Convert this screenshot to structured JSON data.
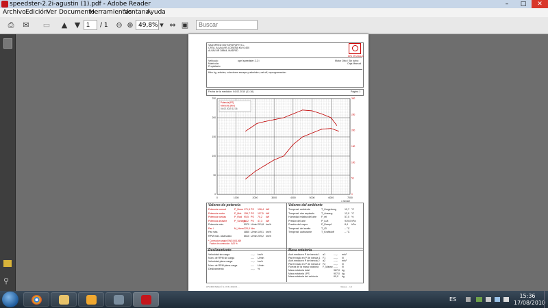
{
  "window": {
    "title": "speedster-2.2i-agustin (1).pdf - Adobe Reader",
    "minimize": "–",
    "maximize": "□",
    "close": "✕"
  },
  "menu": [
    "Archivo",
    "Edición",
    "Ver",
    "Documento",
    "Herramientas",
    "Ventana",
    "Ayuda"
  ],
  "toolbar": {
    "page_current": "1",
    "page_total": "/ 1",
    "zoom": "49,8%",
    "search_placeholder": "Buscar"
  },
  "doc": {
    "company": [
      "VAGSPEED MOTORSPORT S.L.",
      "CRTA. ALVALVIR-COBEÑA KM 0,400",
      "ALVALVIR 28864, MADRID"
    ],
    "logo_caption": "RPS ZTG/MAHA",
    "vehicle_label": "Vehículo:",
    "vehicle_value": "opel speedster 2.2 i",
    "matricula_label": "Matrícula:",
    "prop_label": "Propietario:",
    "motor_label": "Motor Otto / Sin turbo",
    "caja_label": "Caja Manual",
    "note": "filtro kg, arboles, colectores escape y admision, cat.off, reprogramacion.",
    "fecha": "Fecha de la medición: 04.02.2010 (11:16)",
    "pagina": "Página 1",
    "legend": [
      "Potencia [PS]",
      "Momento [Nm]",
      "04.02.2010 11:16"
    ],
    "rpm_unit": "n [U/min]",
    "sec_potencia": "Valores de potencia",
    "sec_ambiente": "Valores del ambiente",
    "sec_deslizamiento": "Deslizamiento",
    "sec_masa": "Masa rotatoria",
    "potencia_rows": [
      [
        "Potencia normal",
        "P_Norm",
        "171,9",
        "PS",
        "126,4",
        "kW"
      ],
      [
        "Potencia motor",
        "P_Mot",
        "159,7",
        "PS",
        "117,5",
        "kW"
      ],
      [
        "Potencia ruedas",
        "P_Rad",
        "95,5",
        "PS",
        "70,2",
        "kW"
      ],
      [
        "Potencia arrastre",
        "P_Schlepp",
        "64,2",
        "PS",
        "47,3",
        "kW"
      ],
      [
        "Potencia máx.",
        "",
        "5570",
        "U/min",
        "201,8",
        "km/h"
      ],
      [
        "Par I",
        "M_Norm",
        "220,0",
        "Nm",
        "",
        ""
      ],
      [
        "Par máx.",
        "",
        "4860",
        "U/min",
        "149,1",
        "km/h"
      ],
      [
        "RPM máx. alcanzado",
        "",
        "6610",
        "U/min",
        "209,2",
        "km/h"
      ]
    ],
    "correccion": [
      "* Corrección según EWG 80/1269",
      "Factor de corrección: 0,00 %"
    ],
    "ambiente_rows": [
      [
        "Temperat. ambiente",
        "T_Umgebung",
        "12,7",
        "°C"
      ],
      [
        "Temperat. aire aspirado",
        "T_Ansaug",
        "12,0",
        "°C"
      ],
      [
        "Humedad relativa del aire",
        "F_rel",
        "57,0",
        "%"
      ],
      [
        "Presión del aire",
        "P_Luft",
        "919,0",
        "hPa"
      ],
      [
        "Presión del vapor",
        "P_Dampf",
        "8,4",
        "hPa"
      ],
      [
        "Temperat. del aceite",
        "T_Öl",
        "-- °C",
        ""
      ],
      [
        "Temperat. carburante",
        "T_Kraftstoff",
        "-- °C",
        ""
      ]
    ],
    "desliz_rows": [
      [
        "Velocidad sin carga",
        "",
        "---,-",
        "km/h"
      ],
      [
        "Núm. de RPM sin carga",
        "",
        "----",
        "U/min"
      ],
      [
        "Velocidad plena carga",
        "",
        "---,-",
        "km/h"
      ],
      [
        "Núm. de RPM plena carga",
        "",
        "----",
        "U/min"
      ],
      [
        "Deslizamiento",
        "",
        "---,-",
        "%"
      ]
    ],
    "masa_rows": [
      [
        "Acel.media en P de inercia 1",
        "a1",
        "---,-",
        "m/s²"
      ],
      [
        "Par.frenado en P de inercia 1",
        "F1",
        "---,-",
        "N"
      ],
      [
        "Acel.media en P de inercia 2",
        "a2",
        "---,-",
        "m/s²"
      ],
      [
        "Par.frenado en P de inercia 2",
        "F2",
        "---,-",
        "N"
      ],
      [
        "Fuerza de la masa rotatoria",
        "F_Masse",
        "---,-",
        "N"
      ],
      [
        "Masa rotatoria total",
        "",
        "967,0",
        "kg"
      ],
      [
        "Masa rotatoria LPS",
        "",
        "907,0",
        "kg"
      ],
      [
        "Masa rotatoria del vehículo",
        "",
        "60,0",
        "kg"
      ]
    ],
    "footer": [
      "LPS 3000 MAHA © 1.2.6.5 | 2010.01 ...",
      "",
      "Valores ... 1/1"
    ]
  },
  "chart_data": {
    "type": "line",
    "xlabel": "n [U/min]",
    "x_ticks": [
      0,
      1000,
      2000,
      3000,
      4000,
      5000,
      6000,
      7000
    ],
    "y_left_ticks": [
      0,
      50,
      100,
      150,
      200,
      250
    ],
    "y_right_ticks": [
      0,
      50,
      100,
      150,
      200,
      250,
      300
    ],
    "grid": true,
    "legend_position": "top-left",
    "series": [
      {
        "name": "Potencia [PS]",
        "color": "#c00000",
        "x": [
          1500,
          2000,
          2500,
          3000,
          3500,
          4000,
          4500,
          5000,
          5500,
          6000,
          6400
        ],
        "y": [
          40,
          60,
          75,
          90,
          100,
          130,
          150,
          160,
          170,
          172,
          165
        ]
      },
      {
        "name": "Momento [Nm]",
        "color": "#c00000",
        "x": [
          1500,
          1800,
          2100,
          2500,
          3000,
          3500,
          4000,
          4500,
          5000,
          5500,
          6000,
          6300
        ],
        "y": [
          165,
          175,
          185,
          190,
          195,
          200,
          210,
          220,
          218,
          210,
          200,
          180
        ]
      }
    ]
  },
  "taskbar": {
    "lang": "ES",
    "time": "15:36",
    "date": "17/08/2010"
  }
}
